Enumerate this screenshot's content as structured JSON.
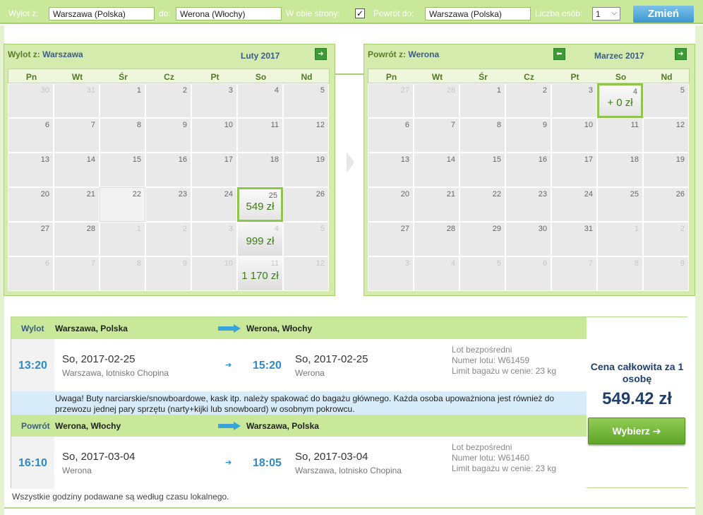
{
  "search": {
    "depart_label": "Wylot z:",
    "depart_value": "Warszawa (Polska)",
    "to_label": "do:",
    "to_value": "Werona (Włochy)",
    "roundtrip_label": "W obie strony:",
    "roundtrip_checked": "✓",
    "return_label": "Powrót do:",
    "return_value": "Warszawa (Polska)",
    "passengers_label": "Liczba osób:",
    "passengers_value": "1",
    "change_button": "Zmień"
  },
  "outbound_calendar": {
    "title_prefix": "Wylot z:",
    "title_city": "Warszawa",
    "month": "Luty 2017",
    "weekdays": [
      "Pn",
      "Wt",
      "Śr",
      "Cz",
      "Pt",
      "So",
      "Nd"
    ],
    "days": [
      "30",
      "31",
      "1",
      "2",
      "3",
      "4",
      "5",
      "6",
      "7",
      "8",
      "9",
      "10",
      "11",
      "12",
      "13",
      "14",
      "15",
      "16",
      "17",
      "18",
      "19",
      "20",
      "21",
      "22",
      "23",
      "24",
      "25",
      "26",
      "27",
      "28",
      "1",
      "2",
      "3",
      "4",
      "5",
      "6",
      "7",
      "8",
      "9",
      "10",
      "11",
      "12"
    ],
    "prices": {
      "25": "549 zł",
      "4b": "999 zł",
      "11b": "1 170 zł"
    }
  },
  "return_calendar": {
    "title_prefix": "Powrót z:",
    "title_city": "Werona",
    "month": "Marzec 2017",
    "weekdays": [
      "Pn",
      "Wt",
      "Śr",
      "Cz",
      "Pt",
      "So",
      "Nd"
    ],
    "days": [
      "27",
      "28",
      "1",
      "2",
      "3",
      "4",
      "5",
      "6",
      "7",
      "8",
      "9",
      "10",
      "11",
      "12",
      "13",
      "14",
      "15",
      "16",
      "17",
      "18",
      "19",
      "20",
      "21",
      "22",
      "23",
      "24",
      "25",
      "26",
      "27",
      "28",
      "29",
      "30",
      "31",
      "1",
      "2",
      "3",
      "4",
      "5",
      "6",
      "7",
      "8",
      "9"
    ],
    "prices": {
      "4": "+ 0 zł"
    }
  },
  "flights": {
    "outbound": {
      "label": "Wylot",
      "from": "Warszawa, Polska",
      "to": "Werona, Włochy",
      "dep_time": "13:20",
      "dep_date": "So, 2017-02-25",
      "dep_place": "Warszawa, lotnisko Chopina",
      "arr_time": "15:20",
      "arr_date": "So, 2017-02-25",
      "arr_place": "Werona",
      "info1": "Lot bezpośredni",
      "info2": "Numer lotu: W61459",
      "info3": "Limit bagażu w cenie: 23 kg"
    },
    "warning": "Uwaga! Buty narciarskie/snowboardowe, kask itp. należy spakować do bagażu głównego. Każda osoba upoważniona jest również do przewozu jednej pary sprzętu (narty+kijki lub snowboard) w osobnym pokrowcu.",
    "return": {
      "label": "Powrót",
      "from": "Werona, Włochy",
      "to": "Warszawa, Polska",
      "dep_time": "16:10",
      "dep_date": "So, 2017-03-04",
      "dep_place": "Werona",
      "arr_time": "18:05",
      "arr_date": "So, 2017-03-04",
      "arr_place": "Warszawa, lotnisko Chopina",
      "info1": "Lot bezpośredni",
      "info2": "Numer lotu: W61460",
      "info3": "Limit bagażu w cenie: 23 kg"
    },
    "total_label": "Cena całkowita za 1 osobę",
    "total_price": "549.42 zł",
    "choose_button": "Wybierz"
  },
  "note": "Wszystkie godziny podawane są według czasu lokalnego.",
  "icons": {
    "next": "arrow-right-icon",
    "prev": "arrow-left-icon"
  },
  "colors": {
    "accent_green": "#8dc64a",
    "price_green": "#3d7d17",
    "time_blue": "#2e8bc9",
    "title_navy": "#1e3f6f"
  }
}
